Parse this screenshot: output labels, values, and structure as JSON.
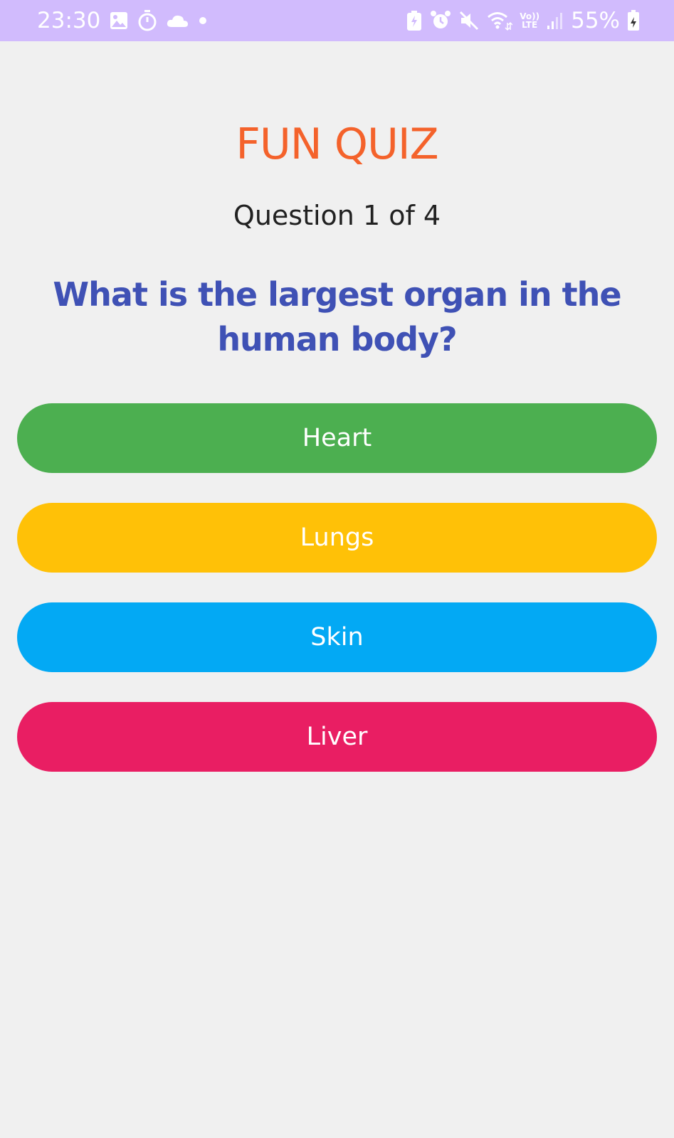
{
  "status_bar": {
    "time": "23:30",
    "battery_percent": "55%",
    "network_label_top": "Vo))",
    "network_label_bottom": "LTE",
    "icons": [
      "gallery-icon",
      "timer-icon",
      "cloud-icon",
      "notification-dot-icon",
      "battery-saver-icon",
      "alarm-icon",
      "mute-icon",
      "wifi-icon",
      "volte-icon",
      "signal-icon",
      "battery-icon"
    ],
    "background_color": "#d1bbfd"
  },
  "quiz": {
    "title": "FUN QUIZ",
    "progress": "Question 1 of 4",
    "question": "What is the largest organ in the human body?",
    "answers": [
      {
        "label": "Heart",
        "color": "#4caf50"
      },
      {
        "label": "Lungs",
        "color": "#ffc107"
      },
      {
        "label": "Skin",
        "color": "#03a9f4"
      },
      {
        "label": "Liver",
        "color": "#e91e63"
      }
    ]
  },
  "colors": {
    "background": "#f0f0f0",
    "title": "#f4622b",
    "question": "#3f51b5",
    "progress": "#212121"
  }
}
